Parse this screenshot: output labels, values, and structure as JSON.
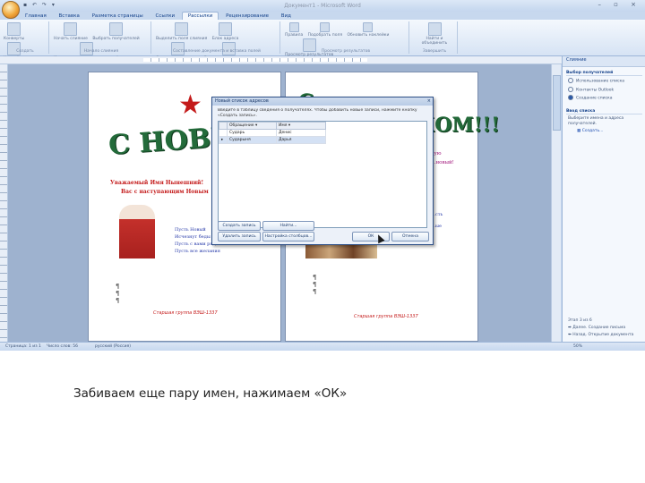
{
  "caption": "Забиваем еще пару имен, нажимаем «ОК»",
  "app": {
    "title": "Документ1 - Microsoft Word",
    "tabs": [
      "Главная",
      "Вставка",
      "Разметка страницы",
      "Ссылки",
      "Рассылки",
      "Рецензирование",
      "Вид"
    ],
    "active_tab": "Рассылки"
  },
  "ribbon": {
    "groups": [
      {
        "caption": "Создать",
        "buttons": [
          "Конверты",
          "Наклейки"
        ]
      },
      {
        "caption": "Начало слияния",
        "buttons": [
          "Начать слияние",
          "Выбрать получателей",
          "Изменить список получателей"
        ]
      },
      {
        "caption": "Составление документа и вставка полей",
        "buttons": [
          "Выделить поля слияния",
          "Блок адреса",
          "Строка приветствия",
          "Вставить поле слияния"
        ]
      },
      {
        "caption": "Просмотр результатов",
        "buttons": [
          "Правила",
          "Подобрать поля",
          "Обновить наклейки",
          "Просмотр результатов"
        ]
      },
      {
        "caption": "Завершить",
        "buttons": [
          "Найти и объединить"
        ]
      }
    ]
  },
  "document": {
    "page1": {
      "title_art": "С НОВЫМ",
      "greeting": [
        "Уважаемый Имя Нынешний!",
        "Вас с наступающим Новым"
      ],
      "verse": [
        "Пусть Новый",
        "Исчезнут беды",
        "Пусть с вами рядом",
        "Пусть все желания"
      ],
      "footer": "Старшая группа ВЭШ-1337"
    },
    "page2": {
      "title_art": "С ПРАЗДНИКОМ!!!",
      "greeting": [
        "…ую",
        "…новый!"
      ],
      "verse": [
        "…сть",
        "…ые"
      ],
      "footer": "Старшая группа ВЭШ-1337"
    }
  },
  "dialog": {
    "title": "Новый список адресов",
    "close": "×",
    "instruction": "Введите в таблицу сведения о получателях. Чтобы добавить новые записи, нажмите кнопку «Создать запись».",
    "columns": [
      "Обращение",
      "Имя"
    ],
    "rows": [
      [
        "Сударь",
        "Денис"
      ],
      [
        "Сударыня",
        "Дарья"
      ]
    ],
    "buttons": {
      "new_entry": "Создать запись",
      "find": "Найти...",
      "delete_entry": "Удалить запись",
      "customize_columns": "Настройка столбцов...",
      "ok": "ОК",
      "cancel": "Отмена"
    }
  },
  "pane": {
    "title": "Слияние",
    "section1": "Выбор получателей",
    "options": [
      "Использование списка",
      "Контакты Outlook",
      "Создание списка"
    ],
    "selected_option": 2,
    "section2": "Ввод списка",
    "description": "Выберите имена и адреса получателей.",
    "link": "Создать...",
    "step": "Этап 3 из 6",
    "next": "Далее. Создание письма",
    "prev": "Назад. Открытие документа"
  },
  "status": {
    "page": "Страница: 1 из 1",
    "words": "Число слов: 56",
    "lang": "русский (Россия)",
    "zoom": "50%"
  },
  "colors": {
    "accent": "#15428b",
    "title_green": "#236b3a",
    "greeting_red": "#c41a1a",
    "verse_blue": "#2437a8"
  }
}
